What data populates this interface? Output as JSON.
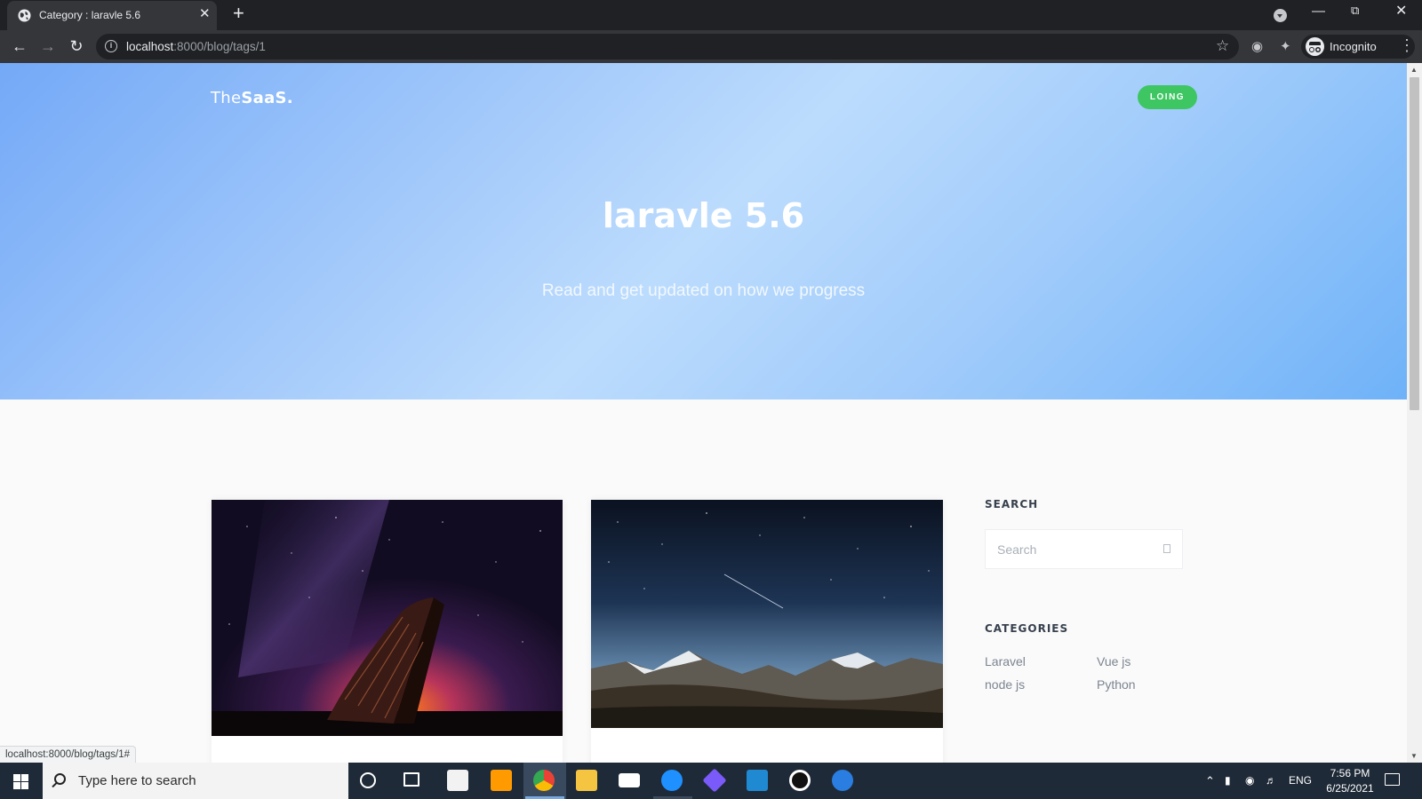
{
  "browser": {
    "tab_title": "Category : laravle 5.6",
    "tab_close": "✕",
    "new_tab": "+",
    "url_host": "localhost",
    "url_path": ":8000/blog/tags/1",
    "profile_label": "Incognito",
    "status_url": "localhost:8000/blog/tags/1#"
  },
  "page": {
    "logo_prefix": "The",
    "logo_bold": "SaaS.",
    "login_label": "LOING",
    "hero_title": "laravle 5.6",
    "hero_subtitle": "Read and get updated on how we progress"
  },
  "posts": [
    {
      "image": "boat-under-night-sky"
    },
    {
      "image": "mountains-under-starry-sky"
    }
  ],
  "sidebar": {
    "search_heading": "SEARCH",
    "search_placeholder": "Search",
    "categories_heading": "CATEGORIES",
    "categories": [
      "Laravel",
      "Vue js",
      "node js",
      "Python"
    ]
  },
  "taskbar": {
    "search_placeholder": "Type here to search",
    "language": "ENG",
    "time": "7:56 PM",
    "date": "6/25/2021"
  },
  "colors": {
    "login_button": "#3ec663",
    "hero_gradient": [
      "#74a9f7",
      "#bcdcfd",
      "#6fb2f8"
    ]
  }
}
